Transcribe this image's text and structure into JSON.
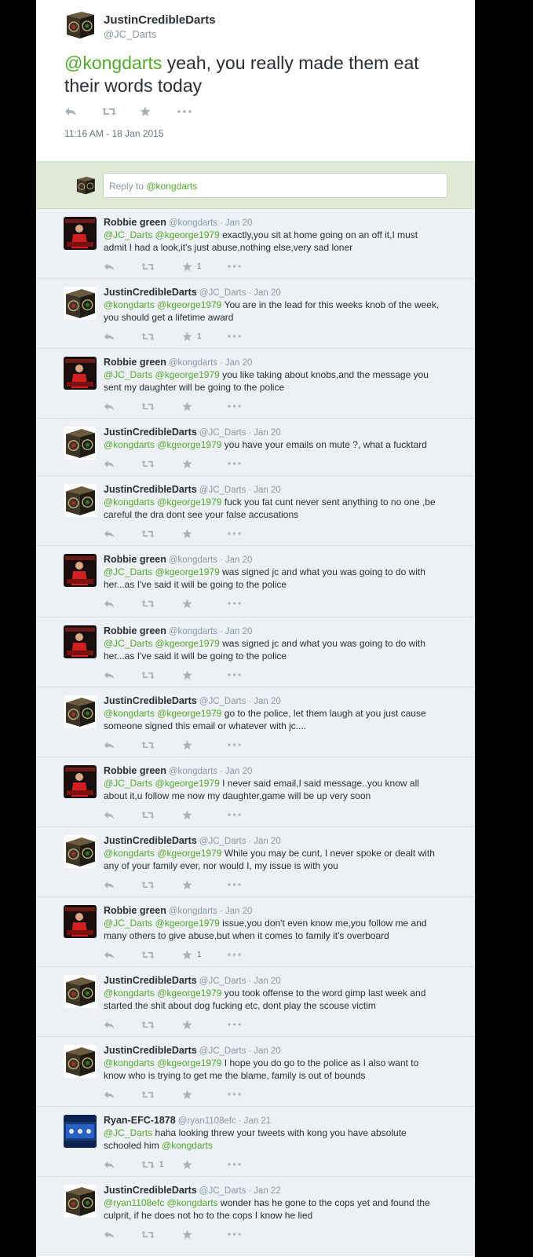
{
  "main_tweet": {
    "author_name": "JustinCredibleDarts",
    "author_handle": "@JC_Darts",
    "mention": "@kongdarts",
    "text": " yeah, you really made them eat their words today",
    "timestamp": "11:16 AM - 18 Jan 2015",
    "avatar": "dartboard-box-avatar"
  },
  "reply_box": {
    "prefix": "Reply to ",
    "mention": "@kongdarts"
  },
  "replies": [
    {
      "name": "Robbie green",
      "handle": "@kongdarts",
      "date": "Jan 20",
      "avatar": "robbie",
      "mentions": "@JC_Darts @kgeorge1979",
      "text": " exactly,you sit at home going on an off it,I must admit I had a look,it's just abuse,nothing else,very sad loner",
      "fav_count": "1",
      "rt_count": ""
    },
    {
      "name": "JustinCredibleDarts",
      "handle": "@JC_Darts",
      "date": "Jan 20",
      "avatar": "jc",
      "mentions": "@kongdarts @kgeorge1979",
      "text": "  You are  in the lead for this weeks knob of the week, you should get a lifetime award",
      "fav_count": "1",
      "rt_count": ""
    },
    {
      "name": "Robbie green",
      "handle": "@kongdarts",
      "date": "Jan 20",
      "avatar": "robbie",
      "mentions": "@JC_Darts @kgeorge1979",
      "text": " you like taking about knobs,and the message you sent my daughter will be going to the police",
      "fav_count": "",
      "rt_count": ""
    },
    {
      "name": "JustinCredibleDarts",
      "handle": "@JC_Darts",
      "date": "Jan 20",
      "avatar": "jc",
      "mentions": "@kongdarts @kgeorge1979",
      "text": "  you have your emails on mute ?, what a fucktard",
      "fav_count": "",
      "rt_count": ""
    },
    {
      "name": "JustinCredibleDarts",
      "handle": "@JC_Darts",
      "date": "Jan 20",
      "avatar": "jc",
      "mentions": "@kongdarts @kgeorge1979",
      "text": "  fuck you fat cunt never sent anything to no one ,be careful the dra dont see your false accusations",
      "fav_count": "",
      "rt_count": ""
    },
    {
      "name": "Robbie green",
      "handle": "@kongdarts",
      "date": "Jan 20",
      "avatar": "robbie",
      "mentions": "@JC_Darts @kgeorge1979",
      "text": " was signed jc and what you was going to do with her...as I've said it will be going to the police",
      "fav_count": "",
      "rt_count": ""
    },
    {
      "name": "Robbie green",
      "handle": "@kongdarts",
      "date": "Jan 20",
      "avatar": "robbie",
      "mentions": "@JC_Darts @kgeorge1979",
      "text": " was signed jc and what you was going to do with her...as I've said it will be going to the police",
      "fav_count": "",
      "rt_count": ""
    },
    {
      "name": "JustinCredibleDarts",
      "handle": "@JC_Darts",
      "date": "Jan 20",
      "avatar": "jc",
      "mentions": "@kongdarts @kgeorge1979",
      "text": "  go to the police, let them laugh at you  just cause someone signed this email or whatever with jc....",
      "fav_count": "",
      "rt_count": ""
    },
    {
      "name": "Robbie green",
      "handle": "@kongdarts",
      "date": "Jan 20",
      "avatar": "robbie",
      "mentions": "@JC_Darts @kgeorge1979",
      "text": " I never said email,I said message..you know all about it,u follow me now my daughter,game will be up very soon",
      "fav_count": "",
      "rt_count": ""
    },
    {
      "name": "JustinCredibleDarts",
      "handle": "@JC_Darts",
      "date": "Jan 20",
      "avatar": "jc",
      "mentions": "@kongdarts @kgeorge1979",
      "text": "  While you may be cunt, I never spoke or dealt with any of your family ever, nor would I, my issue is with you",
      "fav_count": "",
      "rt_count": ""
    },
    {
      "name": "Robbie green",
      "handle": "@kongdarts",
      "date": "Jan 20",
      "avatar": "robbie",
      "mentions": "@JC_Darts @kgeorge1979",
      "text": " issue,you don't even know me,you follow me and many others to give abuse,but when it comes to family it's overboard",
      "fav_count": "1",
      "rt_count": ""
    },
    {
      "name": "JustinCredibleDarts",
      "handle": "@JC_Darts",
      "date": "Jan 20",
      "avatar": "jc",
      "mentions": "@kongdarts @kgeorge1979",
      "text": "  you took offense to the word gimp last week and started the shit about dog fucking etc, dont play the scouse victim",
      "fav_count": "",
      "rt_count": ""
    },
    {
      "name": "JustinCredibleDarts",
      "handle": "@JC_Darts",
      "date": "Jan 20",
      "avatar": "jc",
      "mentions": "@kongdarts @kgeorge1979",
      "text": " I hope you do go to the police as I also want to know who is trying to get me the blame, family is out of bounds",
      "fav_count": "",
      "rt_count": ""
    },
    {
      "name": "Ryan-EFC-1878",
      "handle": "@ryan1108efc",
      "date": "Jan 21",
      "avatar": "ryan",
      "mentions": "@JC_Darts",
      "text": " haha looking threw your tweets with kong you have absolute schooled him ",
      "trailing_mention": "@kongdarts",
      "fav_count": "",
      "rt_count": "1"
    },
    {
      "name": "JustinCredibleDarts",
      "handle": "@JC_Darts",
      "date": "Jan 22",
      "avatar": "jc",
      "mentions": "@ryan1108efc @kongdarts",
      "text": "   wonder has he gone to the cops yet and found the culprit, if he does not ho to the cops I know he lied",
      "fav_count": "",
      "rt_count": ""
    }
  ],
  "colors": {
    "mention": "#55a82f",
    "reply_bg": "#edf1f5",
    "reply_box_bg": "#dfe9d6",
    "side_bg": "#000000"
  }
}
